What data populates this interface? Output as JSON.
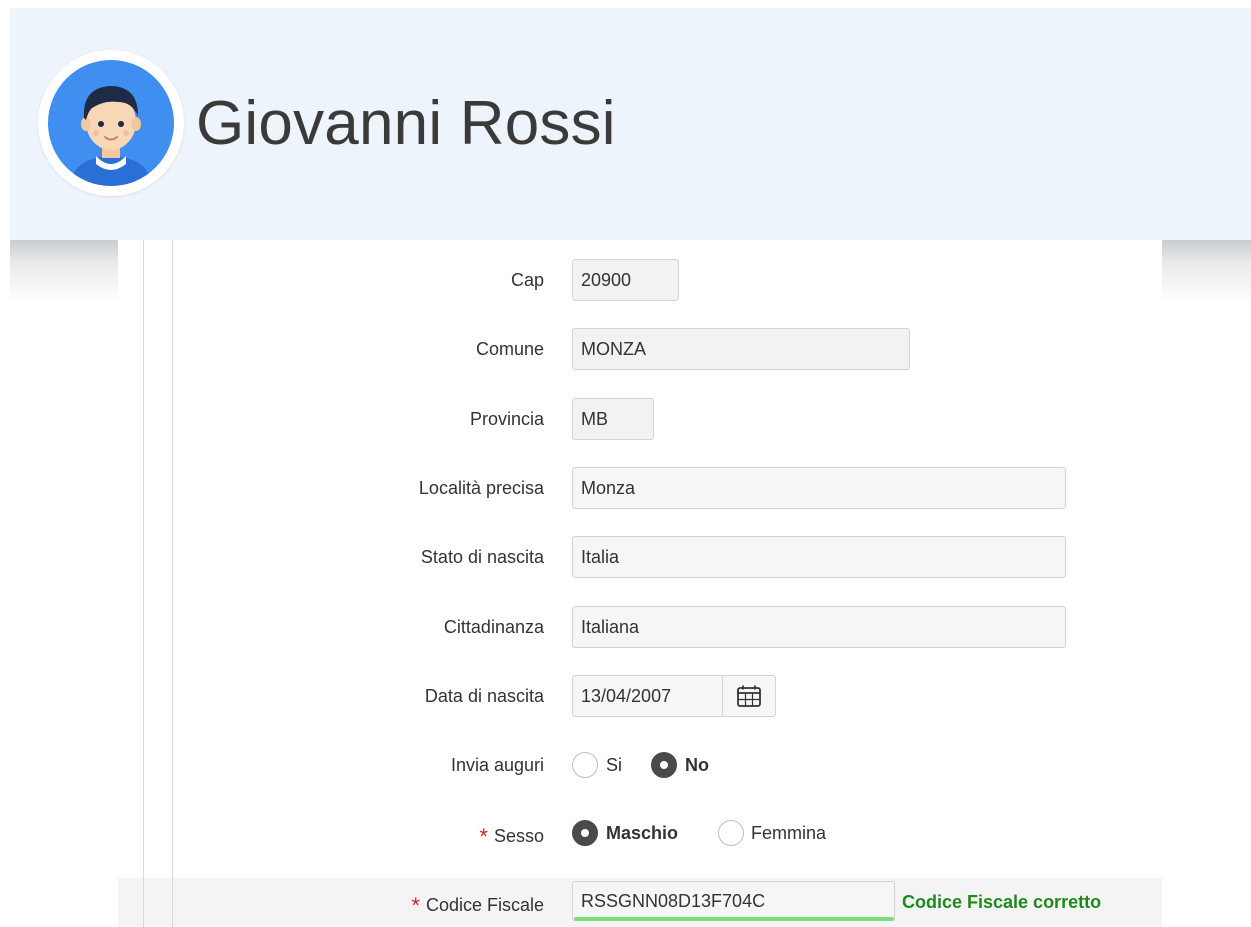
{
  "header": {
    "user_name": "Giovanni Rossi",
    "avatar_icon": "user-avatar-icon"
  },
  "form": {
    "cap": {
      "label": "Cap",
      "value": "20900"
    },
    "comune": {
      "label": "Comune",
      "value": "MONZA"
    },
    "provincia": {
      "label": "Provincia",
      "value": "MB"
    },
    "localita": {
      "label": "Località precisa",
      "value": "Monza"
    },
    "stato_nascita": {
      "label": "Stato di nascita",
      "value": "Italia"
    },
    "cittadinanza": {
      "label": "Cittadinanza",
      "value": "Italiana"
    },
    "data_nascita": {
      "label": "Data di nascita",
      "value": "13/04/2007",
      "icon": "calendar-icon"
    },
    "invia_auguri": {
      "label": "Invia auguri",
      "options": [
        "Si",
        "No"
      ],
      "selected": "No"
    },
    "sesso": {
      "required_mark": "*",
      "label": "Sesso",
      "options": [
        "Maschio",
        "Femmina"
      ],
      "selected": "Maschio"
    },
    "codice_fiscale": {
      "required_mark": "*",
      "label": "Codice Fiscale",
      "value": "RSSGNN08D13F704C",
      "validation_message": "Codice Fiscale corretto"
    }
  },
  "colors": {
    "header_bg": "#eef4fb",
    "avatar_bg": "#3f8ef0",
    "required": "#e02020",
    "valid": "#1e8a1e",
    "valid_underline": "#7be07b"
  }
}
